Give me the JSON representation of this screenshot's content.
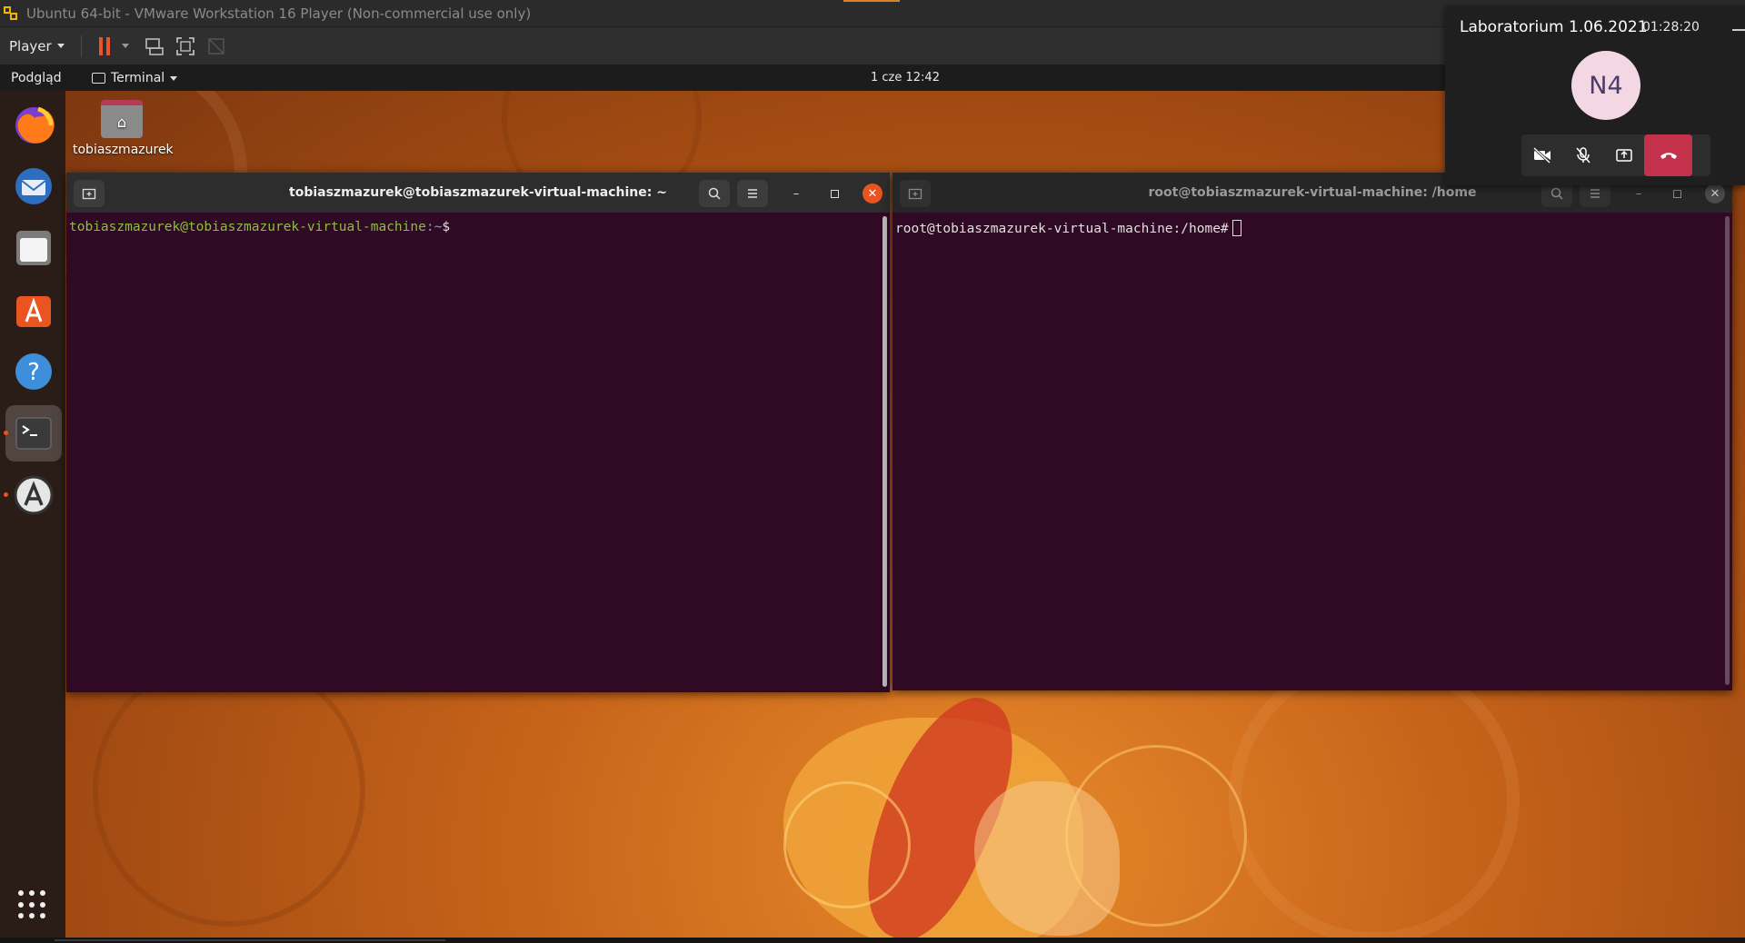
{
  "vmware": {
    "title": "Ubuntu 64-bit - VMware Workstation 16 Player (Non-commercial use only)",
    "player_label": "Player"
  },
  "topbar": {
    "activities": "Podgląd",
    "app_menu": "Terminal",
    "clock": "1 cze  12:42"
  },
  "desktop": {
    "home_folder_label": "tobiaszmazurek"
  },
  "dock": {
    "items": [
      "firefox-icon",
      "thunderbird-icon",
      "files-icon",
      "ubuntu-software-icon",
      "help-icon",
      "terminal-icon",
      "software-updater-icon"
    ],
    "apps_grid": "show-applications-icon"
  },
  "terminal_left": {
    "title": "tobiaszmazurek@tobiaszmazurek-virtual-machine: ~",
    "prompt_user": "tobiaszmazurek@tobiaszmazurek-virtual-machine",
    "prompt_path": ":~",
    "prompt_symbol": "$"
  },
  "terminal_right": {
    "title": "root@tobiaszmazurek-virtual-machine: /home",
    "prompt": "root@tobiaszmazurek-virtual-machine:/home#"
  },
  "call": {
    "meeting_title": "Laboratorium 1.06.2021",
    "timer": "01:28:20",
    "avatar_initials": "N4"
  },
  "colors": {
    "terminal_bg": "#300a24",
    "ubuntu_orange": "#e95420",
    "prompt_green": "#87c23c",
    "prompt_blue": "#6fa0d8",
    "hangup_red": "#c4314b"
  }
}
